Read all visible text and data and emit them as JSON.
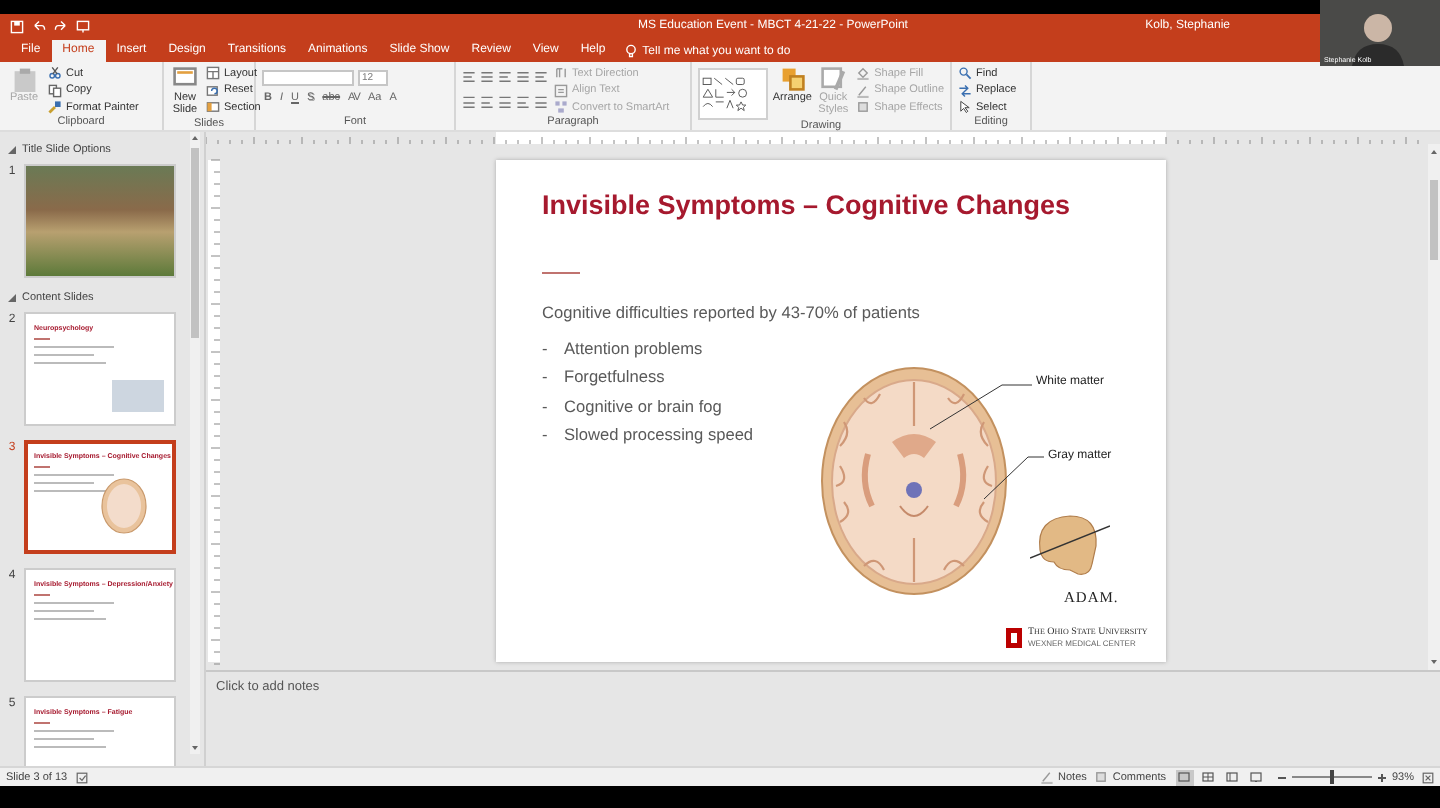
{
  "window": {
    "title": "MS Education Event - MBCT 4-21-22 - PowerPoint",
    "user": "Kolb, Stephanie"
  },
  "video": {
    "caption": "Stephanie Kolb"
  },
  "tabs": [
    {
      "label": "File",
      "selected": false
    },
    {
      "label": "Home",
      "selected": true
    },
    {
      "label": "Insert",
      "selected": false
    },
    {
      "label": "Design",
      "selected": false
    },
    {
      "label": "Transitions",
      "selected": false
    },
    {
      "label": "Animations",
      "selected": false
    },
    {
      "label": "Slide Show",
      "selected": false
    },
    {
      "label": "Review",
      "selected": false
    },
    {
      "label": "View",
      "selected": false
    },
    {
      "label": "Help",
      "selected": false
    }
  ],
  "tell_me": {
    "placeholder": "Tell me what you want to do"
  },
  "ribbon": {
    "groups": [
      {
        "label": "Clipboard",
        "items": [
          {
            "kind": "large",
            "label": "Paste",
            "disabled": true
          },
          {
            "kind": "small",
            "label": "Cut",
            "disabled": false
          },
          {
            "kind": "small",
            "label": "Copy",
            "disabled": false
          },
          {
            "kind": "small",
            "label": "Format Painter",
            "disabled": false
          }
        ]
      },
      {
        "label": "Slides",
        "items": [
          {
            "kind": "large",
            "label": "New Slide",
            "disabled": false
          },
          {
            "kind": "small",
            "label": "Layout",
            "disabled": false
          },
          {
            "kind": "small",
            "label": "Reset",
            "disabled": false
          },
          {
            "kind": "small",
            "label": "Section",
            "disabled": false
          }
        ]
      },
      {
        "label": "Font",
        "items": [
          {
            "kind": "font-controls",
            "size": "12"
          },
          {
            "kind": "format-glyphs",
            "glyphs": [
              "B",
              "I",
              "U",
              "S",
              "abc",
              "AV",
              "Aa",
              "A"
            ]
          }
        ]
      },
      {
        "label": "Paragraph",
        "items": [
          {
            "kind": "paragraph-icons"
          },
          {
            "kind": "small",
            "label": "Text Direction",
            "disabled": true
          },
          {
            "kind": "small",
            "label": "Align Text",
            "disabled": true
          },
          {
            "kind": "small",
            "label": "Convert to SmartArt",
            "disabled": true
          }
        ]
      },
      {
        "label": "Drawing",
        "items": [
          {
            "kind": "shape-gallery"
          },
          {
            "kind": "large",
            "label": "Arrange",
            "disabled": false
          },
          {
            "kind": "large",
            "label": "Quick Styles",
            "disabled": true
          },
          {
            "kind": "small",
            "label": "Shape Fill",
            "disabled": true
          },
          {
            "kind": "small",
            "label": "Shape Outline",
            "disabled": true
          },
          {
            "kind": "small",
            "label": "Shape Effects",
            "disabled": true
          }
        ]
      },
      {
        "label": "Editing",
        "items": [
          {
            "kind": "small",
            "label": "Find",
            "disabled": false
          },
          {
            "kind": "small",
            "label": "Replace",
            "disabled": false
          },
          {
            "kind": "small",
            "label": "Select",
            "disabled": false
          }
        ]
      }
    ]
  },
  "slide_panel": {
    "sections": [
      {
        "title": "Title Slide Options",
        "expanded": true,
        "slides": [
          {
            "number": "1",
            "kind": "photo",
            "selected": false
          }
        ]
      },
      {
        "title": "Content Slides",
        "expanded": true,
        "slides": [
          {
            "number": "2",
            "kind": "text-image",
            "title": "Neuropsychology",
            "selected": false
          },
          {
            "number": "3",
            "kind": "brain",
            "title": "Invisible Symptoms – Cognitive Changes",
            "selected": true
          },
          {
            "number": "4",
            "kind": "text",
            "title": "Invisible Symptoms – Depression/Anxiety",
            "selected": false
          },
          {
            "number": "5",
            "kind": "dark-image",
            "title": "Invisible Symptoms – Fatigue",
            "selected": false
          }
        ]
      }
    ]
  },
  "slide": {
    "title": "Invisible Symptoms – Cognitive Changes",
    "intro": "Cognitive difficulties reported by 43-70% of patients",
    "bullets": [
      {
        "marker": "-",
        "text": "Attention problems"
      },
      {
        "marker": "-",
        "text": "Forgetfulness"
      },
      {
        "marker": "-",
        "text": "Cognitive or brain fog"
      },
      {
        "marker": "-",
        "text": "Slowed processing speed"
      }
    ],
    "figure_labels": [
      "White matter",
      "Gray matter"
    ],
    "credit": "ADAM.",
    "footer": [
      "The Ohio State University",
      "WEXNER MEDICAL CENTER"
    ]
  },
  "notes": {
    "placeholder": "Click to add notes"
  },
  "status_bar": {
    "slide": "Slide 3 of 13",
    "notes": "Notes",
    "comments": "Comments",
    "views": [
      {
        "selected": true
      },
      {
        "selected": false
      },
      {
        "selected": false
      },
      {
        "selected": false
      }
    ],
    "zoom": {
      "level": 0.5,
      "reading": "93%"
    }
  }
}
